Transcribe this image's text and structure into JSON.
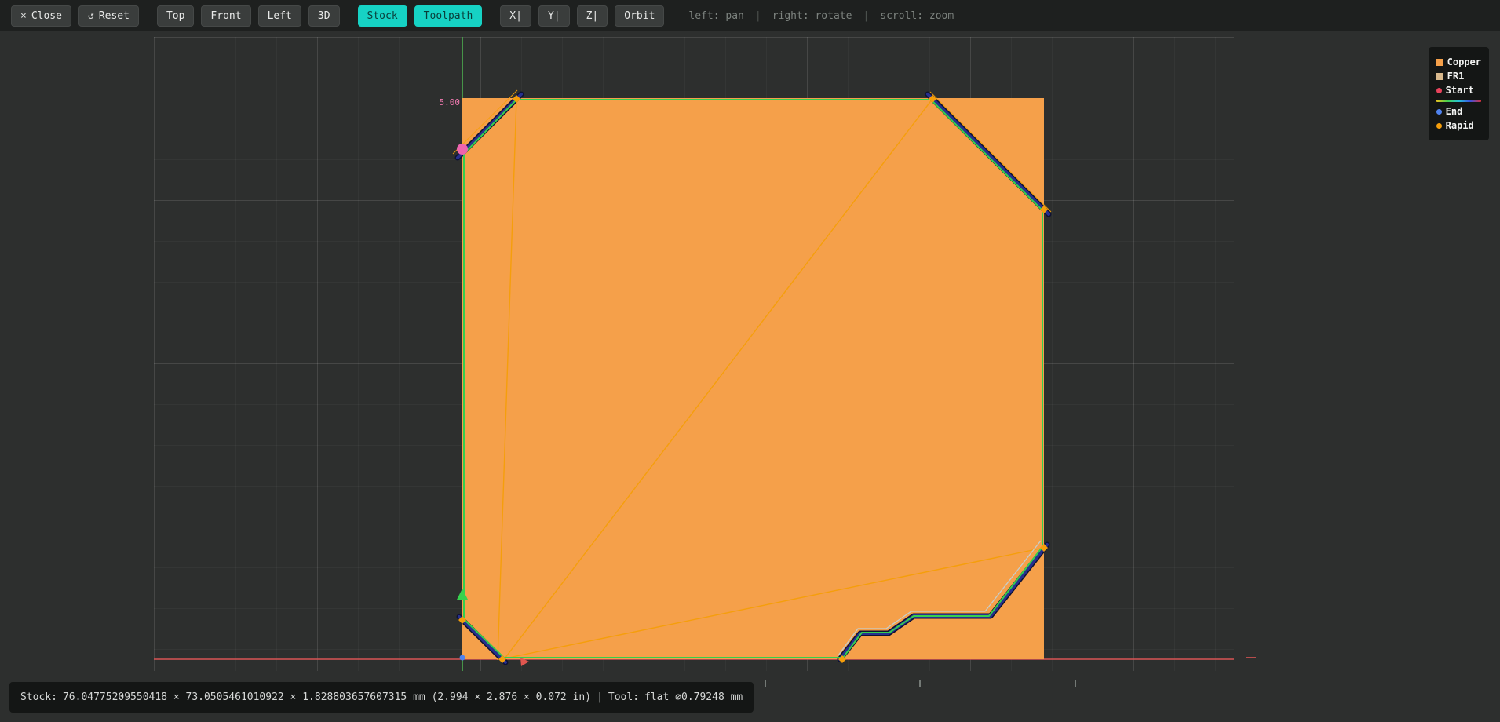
{
  "toolbar": {
    "close": {
      "icon": "×",
      "label": "Close"
    },
    "reset": {
      "icon": "↺",
      "label": "Reset"
    },
    "view_buttons": [
      {
        "label": "Top"
      },
      {
        "label": "Front"
      },
      {
        "label": "Left"
      },
      {
        "label": "3D"
      }
    ],
    "toggle_buttons": [
      {
        "label": "Stock",
        "active": true
      },
      {
        "label": "Toolpath",
        "active": true
      }
    ],
    "axis_buttons": [
      {
        "label": "X|"
      },
      {
        "label": "Y|"
      },
      {
        "label": "Z|"
      }
    ],
    "orbit": {
      "label": "Orbit"
    },
    "hints": [
      {
        "text": "left: pan"
      },
      {
        "text": "right: rotate"
      },
      {
        "text": "scroll: zoom"
      }
    ],
    "hint_separator": "|"
  },
  "legend": {
    "items": [
      {
        "label": "Copper",
        "swatch": "copper-square"
      },
      {
        "label": "FR1",
        "swatch": "fr1-square"
      },
      {
        "label": "Start",
        "swatch": "start-dot"
      },
      {
        "label": "End",
        "swatch": "end-dot"
      },
      {
        "label": "Rapid",
        "swatch": "rapid-dot"
      }
    ]
  },
  "canvas": {
    "dimension_label": "5.00"
  },
  "status_bar": {
    "stock_label": "Stock:",
    "stock_value": "76.04775209550418 × 73.0505461010922 × 1.828803657607315 mm (2.994 × 2.876 × 0.072 in)",
    "separator": "|",
    "tool_label": "Tool:",
    "tool_value": "flat ⌀0.79248 mm"
  },
  "colors": {
    "accent": "#16d2c4",
    "copper": "#f5a04a",
    "fr1": "#d8b88c",
    "start": "#e8435c",
    "end": "#4f82ee",
    "rapid": "#f59e0b",
    "outline": "#35cf4e",
    "cut": "#27308f",
    "axis_x": "#d95555",
    "axis_y": "#4cae4f",
    "start_marker": "#ee64ae"
  }
}
